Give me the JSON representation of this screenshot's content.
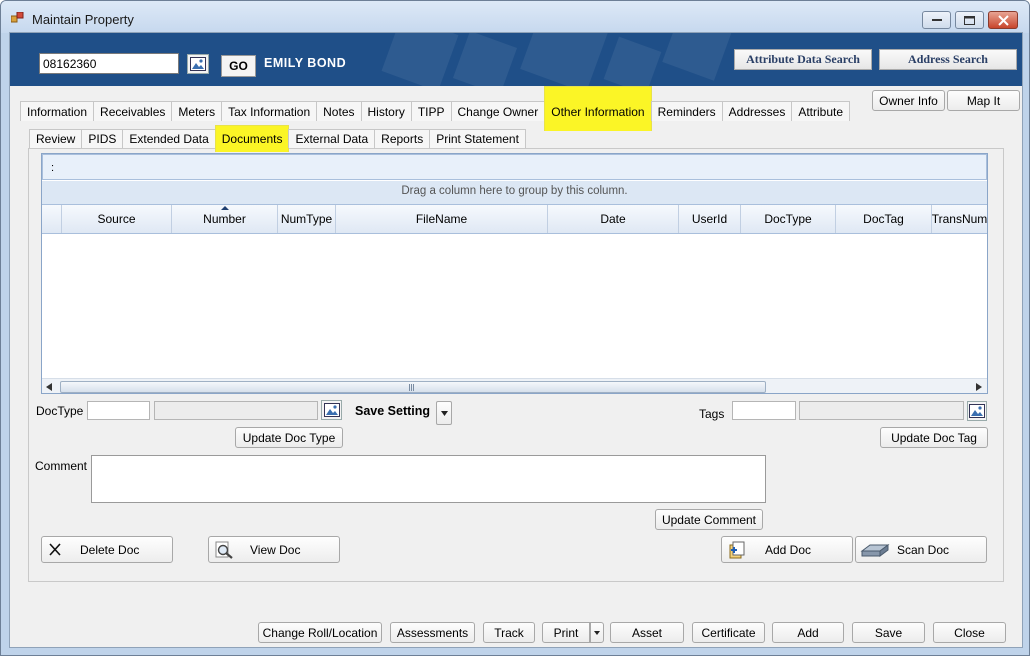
{
  "window": {
    "title": "Maintain Property"
  },
  "header": {
    "account_number": "08162360",
    "go_label": "GO",
    "owner_name": "EMILY  BOND",
    "attribute_search_label": "Attribute Data Search",
    "address_search_label": "Address Search"
  },
  "main_tabs": [
    "Information",
    "Receivables",
    "Meters",
    "Tax Information",
    "Notes",
    "History",
    "TIPP",
    "Change Owner",
    "Other Information",
    "Reminders",
    "Addresses",
    "Attribute"
  ],
  "main_tabs_selected": "Other Information",
  "owner_info_label": "Owner Info",
  "map_it_label": "Map It",
  "sub_tabs": [
    "Review",
    "PIDS",
    "Extended Data",
    "Documents",
    "External Data",
    "Reports",
    "Print Statement"
  ],
  "sub_tabs_selected": "Documents",
  "grid": {
    "top_text": ":",
    "drag_hint": "Drag a column here to group by this column.",
    "columns": [
      "Source",
      "Number",
      "NumType",
      "FileName",
      "Date",
      "UserId",
      "DocType",
      "DocTag",
      "TransNum"
    ],
    "sorted_column": "Number",
    "rows": []
  },
  "form": {
    "doctype_label": "DocType",
    "save_setting_label": "Save Setting",
    "tags_label": "Tags",
    "update_doc_type_label": "Update Doc Type",
    "update_doc_tag_label": "Update Doc Tag",
    "comment_label": "Comment",
    "update_comment_label": "Update Comment"
  },
  "actions": {
    "delete_doc": "Delete Doc",
    "view_doc": "View Doc",
    "add_doc": "Add Doc",
    "scan_doc": "Scan Doc"
  },
  "footer_buttons": {
    "change_roll": "Change Roll/Location",
    "assessments": "Assessments",
    "track": "Track",
    "print": "Print",
    "asset": "Asset",
    "certificate": "Certificate",
    "add": "Add",
    "save": "Save",
    "close": "Close"
  },
  "colors": {
    "header_bg": "#1f4f88",
    "highlight": "#fbf526",
    "window_frame": "#bfd3ea"
  }
}
